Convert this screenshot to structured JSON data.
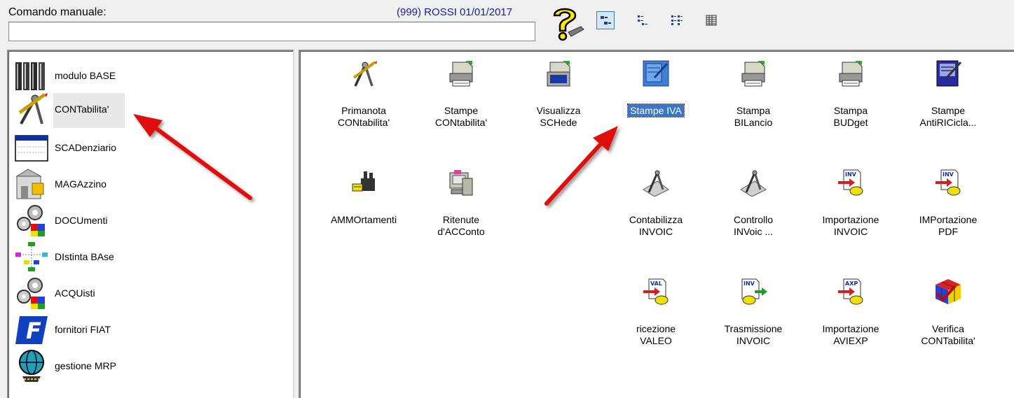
{
  "header": {
    "command_label": "Comando manuale:",
    "command_value": "",
    "user_info": "(999) ROSSI 01/01/2017"
  },
  "toolbar": {
    "icons": [
      "help-icon",
      "large-icons-view-icon",
      "small-icons-view-icon",
      "list-view-icon",
      "details-view-icon"
    ]
  },
  "modules": [
    {
      "label": "modulo BASE",
      "icon": "books-icon"
    },
    {
      "label": "CONTabilita'",
      "icon": "pen-compass-icon"
    },
    {
      "label": "SCADenziario",
      "icon": "calendar-icon"
    },
    {
      "label": "MAGAzzino",
      "icon": "warehouse-icon"
    },
    {
      "label": "DOCUmenti",
      "icon": "gears-icon"
    },
    {
      "label": "DIstinta BAse",
      "icon": "tree-diagram-icon"
    },
    {
      "label": "ACQUisti",
      "icon": "gears-icon"
    },
    {
      "label": "fornitori FIAT",
      "icon": "letter-f-icon"
    },
    {
      "label": "gestione MRP",
      "icon": "globe-icon"
    }
  ],
  "selected_module": "CONTabilita'",
  "apps": [
    {
      "label": "Primanota\nCONtabilita'",
      "icon": "pen-compass-icon"
    },
    {
      "label": "Stampe\nCONtabilita'",
      "icon": "printer-icon"
    },
    {
      "label": "Visualizza\nSCHede",
      "icon": "monitor-icon"
    },
    {
      "label": "Stampe IVA",
      "icon": "document-edit-icon"
    },
    {
      "label": "Stampa\nBILancio",
      "icon": "printer-icon"
    },
    {
      "label": "Stampa\nBUDget",
      "icon": "printer-icon"
    },
    {
      "label": "Stampe\nAntiRICicla...",
      "icon": "notebook-icon"
    },
    {
      "label": "AMMOrtamenti",
      "icon": "factory-icon"
    },
    {
      "label": "Ritenute\nd'ACConto",
      "icon": "computer-icon"
    },
    {
      "label": "Contabilizza\nINVOIC",
      "icon": "compass-icon"
    },
    {
      "label": "Controllo\nINVoic ...",
      "icon": "compass-icon"
    },
    {
      "label": "Importazione\nINVOIC",
      "icon": "inv-import-icon"
    },
    {
      "label": "IMPortazione\nPDF",
      "icon": "inv-import-icon"
    },
    {
      "label": "ricezione\nVALEO",
      "icon": "val-import-icon"
    },
    {
      "label": "Trasmissione\nINVOIC",
      "icon": "inv-export-icon"
    },
    {
      "label": "Importazione\nAVIEXP",
      "icon": "axp-import-icon"
    },
    {
      "label": "Verifica\nCONTabilita'",
      "icon": "cube-check-icon"
    }
  ],
  "selected_app": "Stampe IVA",
  "colors": {
    "annotation_arrow": "#e01010",
    "selection": "#3a77c8",
    "user_info_text": "#1a1aa0"
  }
}
